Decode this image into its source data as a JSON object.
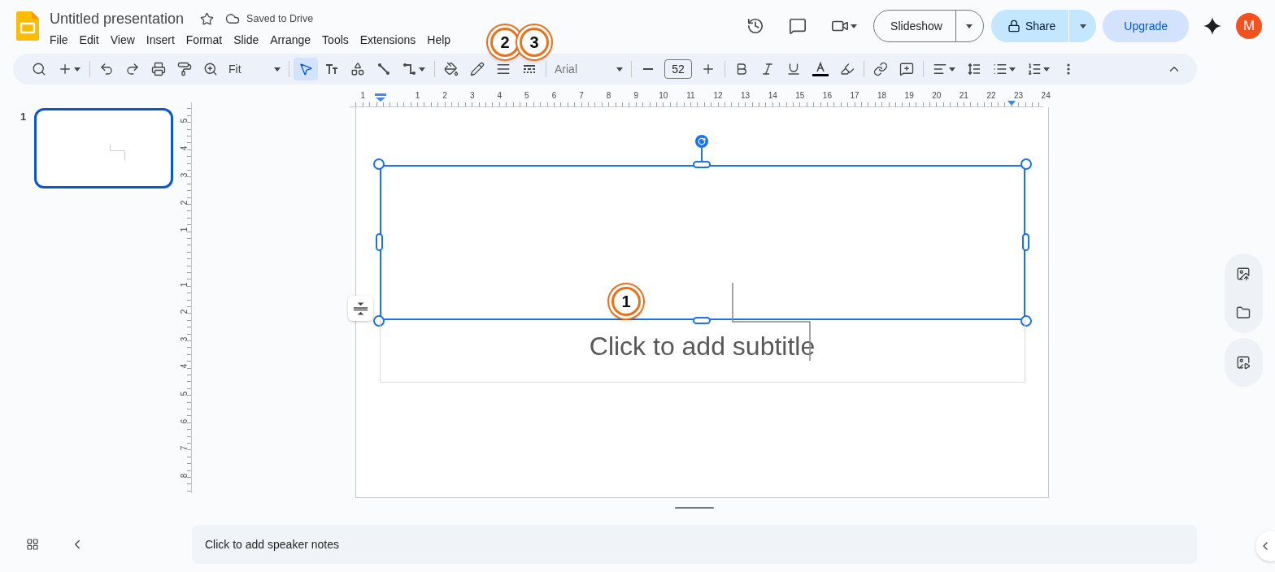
{
  "app": {
    "title": "Untitled presentation",
    "starred": false,
    "save_status": "Saved to Drive",
    "menu": [
      "File",
      "Edit",
      "View",
      "Insert",
      "Format",
      "Slide",
      "Arrange",
      "Tools",
      "Extensions",
      "Help"
    ],
    "slideshow": "Slideshow",
    "share": "Share",
    "upgrade": "Upgrade",
    "avatar": "M"
  },
  "toolbar": {
    "zoom": "Fit",
    "tools": [
      {
        "selected": true
      },
      {
        "selected": false
      },
      {
        "selected": false
      },
      {
        "selected": false
      },
      {
        "selected": false
      }
    ],
    "font": "Arial",
    "font_size": "52"
  },
  "rulers": {
    "horizontal": {
      "before_zero": [
        "1"
      ],
      "after_zero": [
        "1",
        "2",
        "3",
        "4",
        "5",
        "6",
        "7",
        "8",
        "9",
        "10",
        "11",
        "12",
        "13",
        "14",
        "15",
        "16",
        "17",
        "18",
        "19",
        "20",
        "21",
        "22",
        "23",
        "24"
      ]
    },
    "vertical": {
      "above_zero": [
        "5",
        "4",
        "3",
        "2",
        "1"
      ],
      "below_zero": [
        "1",
        "2",
        "3",
        "4",
        "5",
        "6",
        "7",
        "8"
      ]
    }
  },
  "slides": [
    {
      "number": "1",
      "selected": true
    }
  ],
  "slide": {
    "title_box_selected": true,
    "subtitle_prompt": "Click to add subtitle"
  },
  "notes": {
    "placeholder": "Click to add speaker notes"
  },
  "markers": [
    {
      "label": "1"
    },
    {
      "label": "2"
    },
    {
      "label": "3"
    }
  ]
}
